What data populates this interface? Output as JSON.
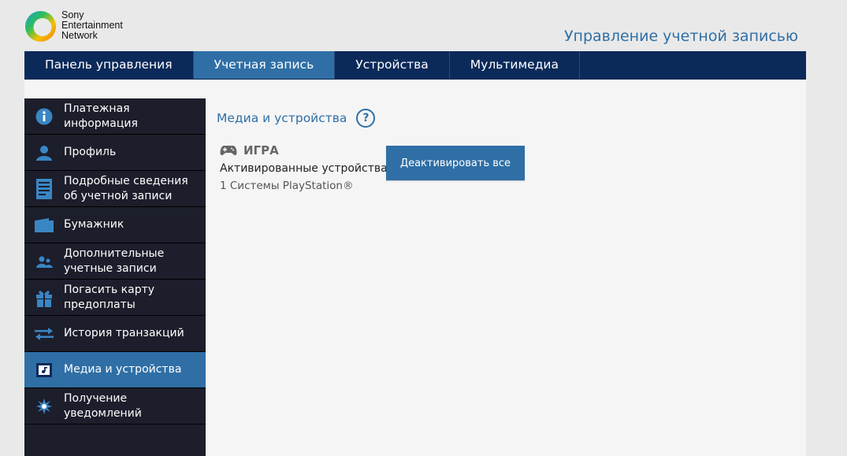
{
  "logo": {
    "lines": [
      "Sony",
      "Entertainment",
      "Network"
    ]
  },
  "page_heading": "Управление учетной записью",
  "topnav": {
    "tabs": [
      {
        "label": "Панель управления",
        "active": false
      },
      {
        "label": "Учетная запись",
        "active": true
      },
      {
        "label": "Устройства",
        "active": false
      },
      {
        "label": "Мультимедиа",
        "active": false
      }
    ]
  },
  "sidebar": {
    "items": [
      {
        "label": "Платежная информация",
        "icon": "info-icon"
      },
      {
        "label": "Профиль",
        "icon": "person-icon"
      },
      {
        "label": "Подробные сведения об учетной записи",
        "icon": "document-icon"
      },
      {
        "label": "Бумажник",
        "icon": "wallet-icon"
      },
      {
        "label": "Дополнительные учетные записи",
        "icon": "sub-accounts-icon"
      },
      {
        "label": "Погасить карту предоплаты",
        "icon": "gift-icon"
      },
      {
        "label": "История транзакций",
        "icon": "transfer-arrows-icon"
      },
      {
        "label": "Медиа и устройства",
        "icon": "media-icon",
        "active": true
      },
      {
        "label": "Получение уведомлений",
        "icon": "burst-icon"
      }
    ]
  },
  "main": {
    "section_title": "Медиа и устройства",
    "help_glyph": "?",
    "game": {
      "heading": "ИГРА",
      "activated_label": "Активированные устройства",
      "systems_count": "1 Системы PlayStation®",
      "deactivate_label": "Деактивировать все"
    }
  },
  "colors": {
    "accent": "#2f6fa6",
    "nav_bg": "#0b2a5a",
    "sidebar_bg": "#1c1e2b"
  }
}
